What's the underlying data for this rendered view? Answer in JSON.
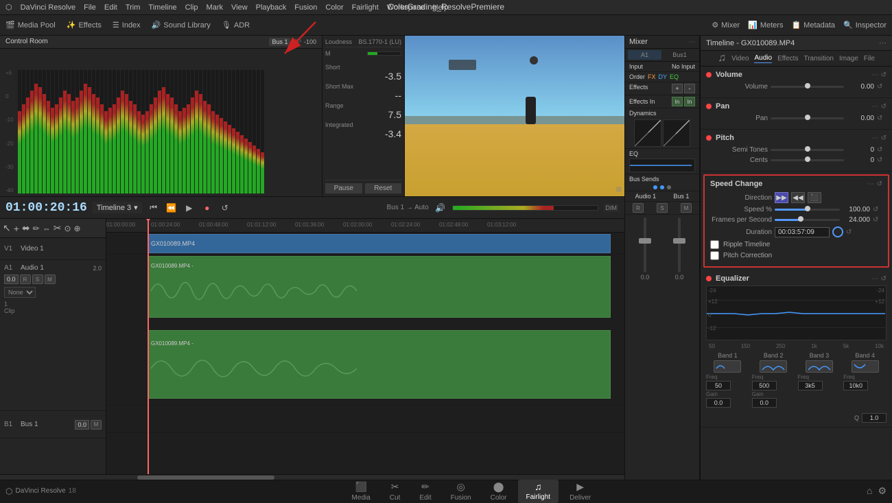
{
  "app": {
    "name": "DaVinci Resolve",
    "version": "18",
    "project_title": "ColorGrading_ResolvePremiere"
  },
  "menu": {
    "items": [
      "DaVinci Resolve",
      "File",
      "Edit",
      "Trim",
      "Timeline",
      "Clip",
      "Mark",
      "View",
      "Playback",
      "Fusion",
      "Color",
      "Fairlight",
      "Workspace",
      "Help"
    ]
  },
  "toolbar": {
    "items": [
      "Media Pool",
      "Effects",
      "Index",
      "Sound Library",
      "ADR"
    ]
  },
  "transport": {
    "timecode": "01:00:20:16",
    "timeline_name": "Timeline 3",
    "bus_label": "Bus 1",
    "auto_label": "Auto"
  },
  "control_room": {
    "label": "Control Room",
    "bus_label": "Bus 1",
    "tp_label": "TP",
    "tp_value": "-100"
  },
  "loudness": {
    "label": "Loudness",
    "format": "BS.1770-1 (LU)",
    "short_label": "Short",
    "short_value": "-3.5",
    "short_max_label": "Short Max",
    "short_max_value": "--",
    "range_label": "Range",
    "range_value": "7.5",
    "integrated_label": "Integrated",
    "integrated_value": "-3.4",
    "m_label": "M"
  },
  "timeline": {
    "tracks": [
      {
        "id": "V1",
        "name": "Video 1",
        "type": "video"
      },
      {
        "id": "A1",
        "name": "Audio 1",
        "type": "audio",
        "level": "2.0"
      },
      {
        "id": "B1",
        "name": "Bus 1",
        "type": "bus"
      }
    ],
    "ruler_marks": [
      "01:00:00:00",
      "01:00:24:00",
      "01:00:48:00",
      "01:01:12:00",
      "01:01:36:00",
      "01:02:00:00",
      "01:02:24:00",
      "01:02:48:00",
      "01:03:12:00"
    ],
    "clip_name": "GX010089.MP4",
    "clips": 1
  },
  "mixer": {
    "title": "Mixer",
    "channels": [
      {
        "id": "A1",
        "label": "A1"
      },
      {
        "id": "Bus1",
        "label": "Bus1"
      }
    ],
    "input_label": "Input",
    "input_value": "No Input",
    "order_label": "Order",
    "order_fx": "FX",
    "order_dy": "DY",
    "order_eq": "EQ",
    "effects_label": "Effects",
    "effects_in_label": "Effects In",
    "dynamics_label": "Dynamics",
    "eq_label": "EQ",
    "bus_sends_label": "Bus Sends",
    "audio_label": "Audio 1",
    "bus_label": "Bus 1"
  },
  "inspector": {
    "title": "Timeline - GX010089.MP4",
    "tabs": [
      "Video",
      "Audio",
      "Effects",
      "Transition",
      "Image",
      "File"
    ],
    "active_tab": "Audio",
    "sections": {
      "volume": {
        "title": "Volume",
        "params": [
          {
            "label": "Volume",
            "value": "0.00"
          }
        ]
      },
      "pan": {
        "title": "Pan",
        "params": [
          {
            "label": "Pan",
            "value": "0.00"
          }
        ]
      },
      "pitch": {
        "title": "Pitch",
        "params": [
          {
            "label": "Semi Tones",
            "value": "0"
          },
          {
            "label": "Cents",
            "value": "0"
          }
        ]
      },
      "speed_change": {
        "title": "Speed Change",
        "direction_label": "Direction",
        "speed_label": "Speed %",
        "speed_value": "100.00",
        "fps_label": "Frames per Second",
        "fps_value": "24.000",
        "duration_label": "Duration",
        "duration_value": "00:03:57:09",
        "ripple_timeline_label": "Ripple Timeline",
        "pitch_correction_label": "Pitch Correction"
      },
      "equalizer": {
        "title": "Equalizer",
        "bands": [
          {
            "label": "Band 1",
            "freq": "50",
            "gain": "0.0"
          },
          {
            "label": "Band 2",
            "freq": "500",
            "gain": "0.0"
          },
          {
            "label": "Band 3",
            "freq": "3k5"
          },
          {
            "label": "Band 4",
            "freq": "10k0"
          }
        ],
        "freq_labels": [
          "50",
          "150",
          "250",
          "1k",
          "5k",
          "10k"
        ],
        "q_label": "Q",
        "q_value": "1.0"
      }
    }
  },
  "bottom_nav": {
    "tabs": [
      "Media",
      "Cut",
      "Edit",
      "Fusion",
      "Color",
      "Fairlight",
      "Deliver"
    ],
    "active": "Fairlight"
  },
  "icons": {
    "mixer": "♫",
    "meters": "📊",
    "metadata": "📋",
    "inspector": "🔍",
    "media_pool": "🎬",
    "effects": "✨",
    "index": "☰",
    "sound_library": "🔊",
    "adr": "🎙",
    "forward": "▶",
    "rewind": "◀◀",
    "fast_forward": "▶▶",
    "play": "▶",
    "stop": "■",
    "record": "●",
    "loop": "↺",
    "arrow_forward": "→",
    "arrow_back": "←",
    "home": "⌂",
    "settings": "⚙"
  }
}
